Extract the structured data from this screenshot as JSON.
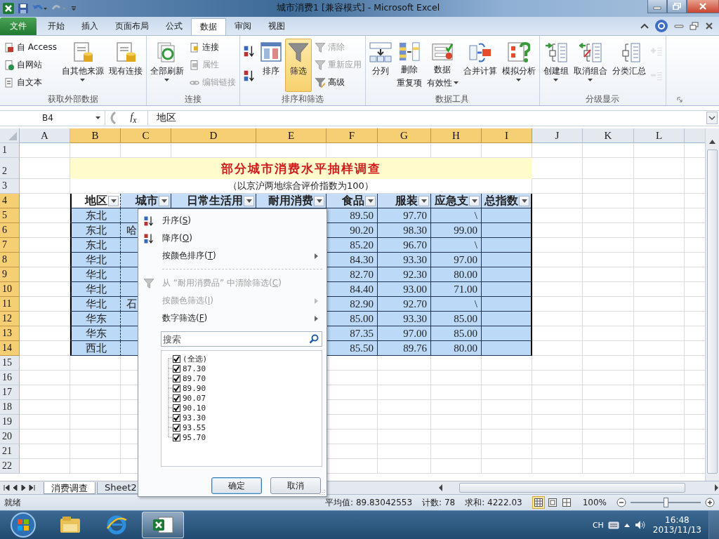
{
  "window": {
    "title": "城市消费1  [兼容模式]  -  Microsoft Excel"
  },
  "ribbon_tabs": [
    {
      "label": "文件",
      "kind": "file",
      "selected": false
    },
    {
      "label": "开始",
      "kind": "tab",
      "selected": false
    },
    {
      "label": "插入",
      "kind": "tab",
      "selected": false
    },
    {
      "label": "页面布局",
      "kind": "tab",
      "selected": false
    },
    {
      "label": "公式",
      "kind": "tab",
      "selected": false
    },
    {
      "label": "数据",
      "kind": "tab",
      "selected": true
    },
    {
      "label": "审阅",
      "kind": "tab",
      "selected": false
    },
    {
      "label": "视图",
      "kind": "tab",
      "selected": false
    }
  ],
  "ribbon_groups": [
    {
      "label": "获取外部数据",
      "controls": [
        {
          "kind": "stack",
          "items": [
            {
              "kind": "small",
              "label": "自 Access",
              "disabled": false
            },
            {
              "kind": "small",
              "label": "自网站",
              "disabled": false
            },
            {
              "kind": "small",
              "label": "自文本",
              "disabled": false
            }
          ]
        },
        {
          "kind": "large",
          "lines": [
            "自其他来源"
          ],
          "dropdown": true,
          "pressed": false,
          "disabled": false
        },
        {
          "kind": "large",
          "lines": [
            "现有连接"
          ],
          "dropdown": false,
          "pressed": false,
          "disabled": false
        }
      ]
    },
    {
      "label": "连接",
      "controls": [
        {
          "kind": "large",
          "lines": [
            "全部刷新"
          ],
          "dropdown": true,
          "pressed": false,
          "disabled": false
        },
        {
          "kind": "stack",
          "items": [
            {
              "kind": "small",
              "label": "连接",
              "disabled": false
            },
            {
              "kind": "small",
              "label": "属性",
              "disabled": true
            },
            {
              "kind": "small",
              "label": "编辑链接",
              "disabled": true
            }
          ]
        }
      ]
    },
    {
      "label": "排序和筛选",
      "controls": [
        {
          "kind": "stack",
          "items": [
            {
              "kind": "icon",
              "disabled": false
            },
            {
              "kind": "icon",
              "disabled": false
            }
          ]
        },
        {
          "kind": "large",
          "lines": [
            "排序"
          ],
          "dropdown": false,
          "pressed": false,
          "disabled": false
        },
        {
          "kind": "large",
          "lines": [
            "筛选"
          ],
          "dropdown": false,
          "pressed": true,
          "disabled": false
        },
        {
          "kind": "stack",
          "items": [
            {
              "kind": "small",
              "label": "清除",
              "disabled": true
            },
            {
              "kind": "small",
              "label": "重新应用",
              "disabled": true
            },
            {
              "kind": "small",
              "label": "高级",
              "disabled": false
            }
          ]
        }
      ]
    },
    {
      "label": "数据工具",
      "controls": [
        {
          "kind": "large",
          "lines": [
            "分列"
          ],
          "dropdown": false,
          "pressed": false,
          "disabled": false
        },
        {
          "kind": "large",
          "lines": [
            "删除",
            "重复项"
          ],
          "dropdown": false,
          "pressed": false,
          "disabled": false
        },
        {
          "kind": "large",
          "lines": [
            "数据",
            "有效性"
          ],
          "dropdown": true,
          "pressed": false,
          "disabled": false
        },
        {
          "kind": "large",
          "lines": [
            "合并计算"
          ],
          "dropdown": false,
          "pressed": false,
          "disabled": false
        },
        {
          "kind": "large",
          "lines": [
            "模拟分析"
          ],
          "dropdown": true,
          "pressed": false,
          "disabled": false
        }
      ]
    },
    {
      "label": "分级显示",
      "controls": [
        {
          "kind": "large",
          "lines": [
            "创建组"
          ],
          "dropdown": true,
          "pressed": false,
          "disabled": false
        },
        {
          "kind": "large",
          "lines": [
            "取消组合"
          ],
          "dropdown": true,
          "pressed": false,
          "disabled": false
        },
        {
          "kind": "large",
          "lines": [
            "分类汇总"
          ],
          "dropdown": false,
          "pressed": false,
          "disabled": false
        },
        {
          "kind": "stack",
          "items": [
            {
              "kind": "icon",
              "disabled": true
            },
            {
              "kind": "icon",
              "disabled": true
            }
          ]
        }
      ]
    }
  ],
  "formula_bar": {
    "name_box": "B4",
    "function_label": "f$_{x}$",
    "value": "地区"
  },
  "columns": [
    {
      "label": "A",
      "selected": false
    },
    {
      "label": "B",
      "selected": true
    },
    {
      "label": "C",
      "selected": true
    },
    {
      "label": "D",
      "selected": true
    },
    {
      "label": "E",
      "selected": true
    },
    {
      "label": "F",
      "selected": true
    },
    {
      "label": "G",
      "selected": true
    },
    {
      "label": "H",
      "selected": true
    },
    {
      "label": "I",
      "selected": true
    },
    {
      "label": "J",
      "selected": false
    },
    {
      "label": "K",
      "selected": false
    },
    {
      "label": "L",
      "selected": false
    }
  ],
  "rows": [
    {
      "number": "1",
      "selected": false,
      "kind": "blank"
    },
    {
      "number": "2",
      "selected": false,
      "kind": "title",
      "text": "部分城市消费水平抽样调查"
    },
    {
      "number": "3",
      "selected": false,
      "kind": "subtitle",
      "text": "（以京沪两地综合评价指数为100）"
    },
    {
      "number": "4",
      "selected": true,
      "kind": "header",
      "cells": [
        {
          "text": "地区",
          "active": true
        },
        {
          "text": "城市",
          "active": false
        },
        {
          "text": "日常生活用",
          "active": false
        },
        {
          "text": "耐用消费",
          "active": false
        },
        {
          "text": "食品",
          "active": false
        },
        {
          "text": "服装",
          "active": false
        },
        {
          "text": "应急支",
          "active": false
        },
        {
          "text": "总指数",
          "active": false
        }
      ]
    },
    {
      "number": "5",
      "selected": true,
      "kind": "data",
      "region": "东北",
      "food": "89.50",
      "clothing": "97.70",
      "emergency": "\\"
    },
    {
      "number": "6",
      "selected": true,
      "kind": "data",
      "region": "东北",
      "city": "哈",
      "food": "90.20",
      "clothing": "98.30",
      "emergency": "99.00"
    },
    {
      "number": "7",
      "selected": true,
      "kind": "data",
      "region": "东北",
      "food": "85.20",
      "clothing": "96.70",
      "emergency": "\\"
    },
    {
      "number": "8",
      "selected": true,
      "kind": "data",
      "region": "华北",
      "food": "84.30",
      "clothing": "93.30",
      "emergency": "97.00"
    },
    {
      "number": "9",
      "selected": true,
      "kind": "data",
      "region": "华北",
      "food": "82.70",
      "clothing": "92.30",
      "emergency": "80.00"
    },
    {
      "number": "10",
      "selected": true,
      "kind": "data",
      "region": "华北",
      "food": "84.40",
      "clothing": "93.00",
      "emergency": "71.00"
    },
    {
      "number": "11",
      "selected": true,
      "kind": "data",
      "region": "华北",
      "city": "石",
      "food": "82.90",
      "clothing": "92.70",
      "emergency": "\\"
    },
    {
      "number": "12",
      "selected": true,
      "kind": "data",
      "region": "华东",
      "food": "85.00",
      "clothing": "93.30",
      "emergency": "85.00"
    },
    {
      "number": "13",
      "selected": true,
      "kind": "data",
      "region": "华东",
      "food": "87.35",
      "clothing": "97.00",
      "emergency": "85.00"
    },
    {
      "number": "14",
      "selected": true,
      "kind": "data",
      "region": "西北",
      "food": "85.50",
      "clothing": "89.76",
      "emergency": "80.00"
    },
    {
      "number": "15",
      "selected": false,
      "kind": "blank"
    },
    {
      "number": "16",
      "selected": false,
      "kind": "blank"
    },
    {
      "number": "17",
      "selected": false,
      "kind": "blank"
    },
    {
      "number": "18",
      "selected": false,
      "kind": "blank"
    },
    {
      "number": "19",
      "selected": false,
      "kind": "blank"
    },
    {
      "number": "20",
      "selected": false,
      "kind": "blank"
    },
    {
      "number": "21",
      "selected": false,
      "kind": "blank"
    },
    {
      "number": "22",
      "selected": false,
      "kind": "blank"
    }
  ],
  "filter_menu": {
    "items": [
      {
        "kind": "command",
        "label": "升序(",
        "key": "S",
        "end": ")",
        "disabled": false,
        "submenu": false
      },
      {
        "kind": "command",
        "label": "降序(",
        "key": "O",
        "end": ")",
        "disabled": false,
        "submenu": false
      },
      {
        "kind": "command",
        "label": "按颜色排序(",
        "key": "T",
        "end": ")",
        "disabled": false,
        "submenu": true
      },
      {
        "kind": "separator"
      },
      {
        "kind": "command",
        "label": "从 “耐用消费品” 中清除筛选(",
        "key": "C",
        "end": ")",
        "disabled": true,
        "submenu": false
      },
      {
        "kind": "command",
        "label": "按颜色筛选(",
        "key": "I",
        "end": ")",
        "disabled": true,
        "submenu": true
      },
      {
        "kind": "command",
        "label": "数字筛选(",
        "key": "F",
        "end": ")",
        "disabled": false,
        "submenu": true
      }
    ],
    "search": {
      "placeholder": "搜索"
    },
    "values": [
      {
        "label": "(全选)",
        "checked": true
      },
      {
        "label": "87.30",
        "checked": true
      },
      {
        "label": "89.70",
        "checked": true
      },
      {
        "label": "89.90",
        "checked": true
      },
      {
        "label": "90.07",
        "checked": true
      },
      {
        "label": "90.10",
        "checked": true
      },
      {
        "label": "93.30",
        "checked": true
      },
      {
        "label": "93.55",
        "checked": true
      },
      {
        "label": "95.70",
        "checked": true
      }
    ],
    "buttons": [
      "确定",
      "取消"
    ]
  },
  "sheet_tabs": [
    {
      "label": "消费调查",
      "selected": true
    },
    {
      "label": "Sheet2",
      "selected": false
    }
  ],
  "status_bar": {
    "mode": "就绪",
    "average": "平均值: 89.83042553",
    "count": "计数: 78",
    "sum": "求和: 4222.03",
    "views": [
      {
        "kind": "normal",
        "selected": true
      },
      {
        "kind": "page-layout",
        "selected": false
      },
      {
        "kind": "page-break",
        "selected": false
      }
    ],
    "zoom": {
      "label": "100%",
      "level": 0.5
    }
  },
  "taskbar": {
    "apps": [
      {
        "kind": "folder",
        "selected": false
      },
      {
        "kind": "browser",
        "selected": false
      },
      {
        "kind": "spreadsheet",
        "selected": true
      }
    ],
    "input_language": "CH",
    "time": "16:48",
    "date": "2013/11/13"
  }
}
